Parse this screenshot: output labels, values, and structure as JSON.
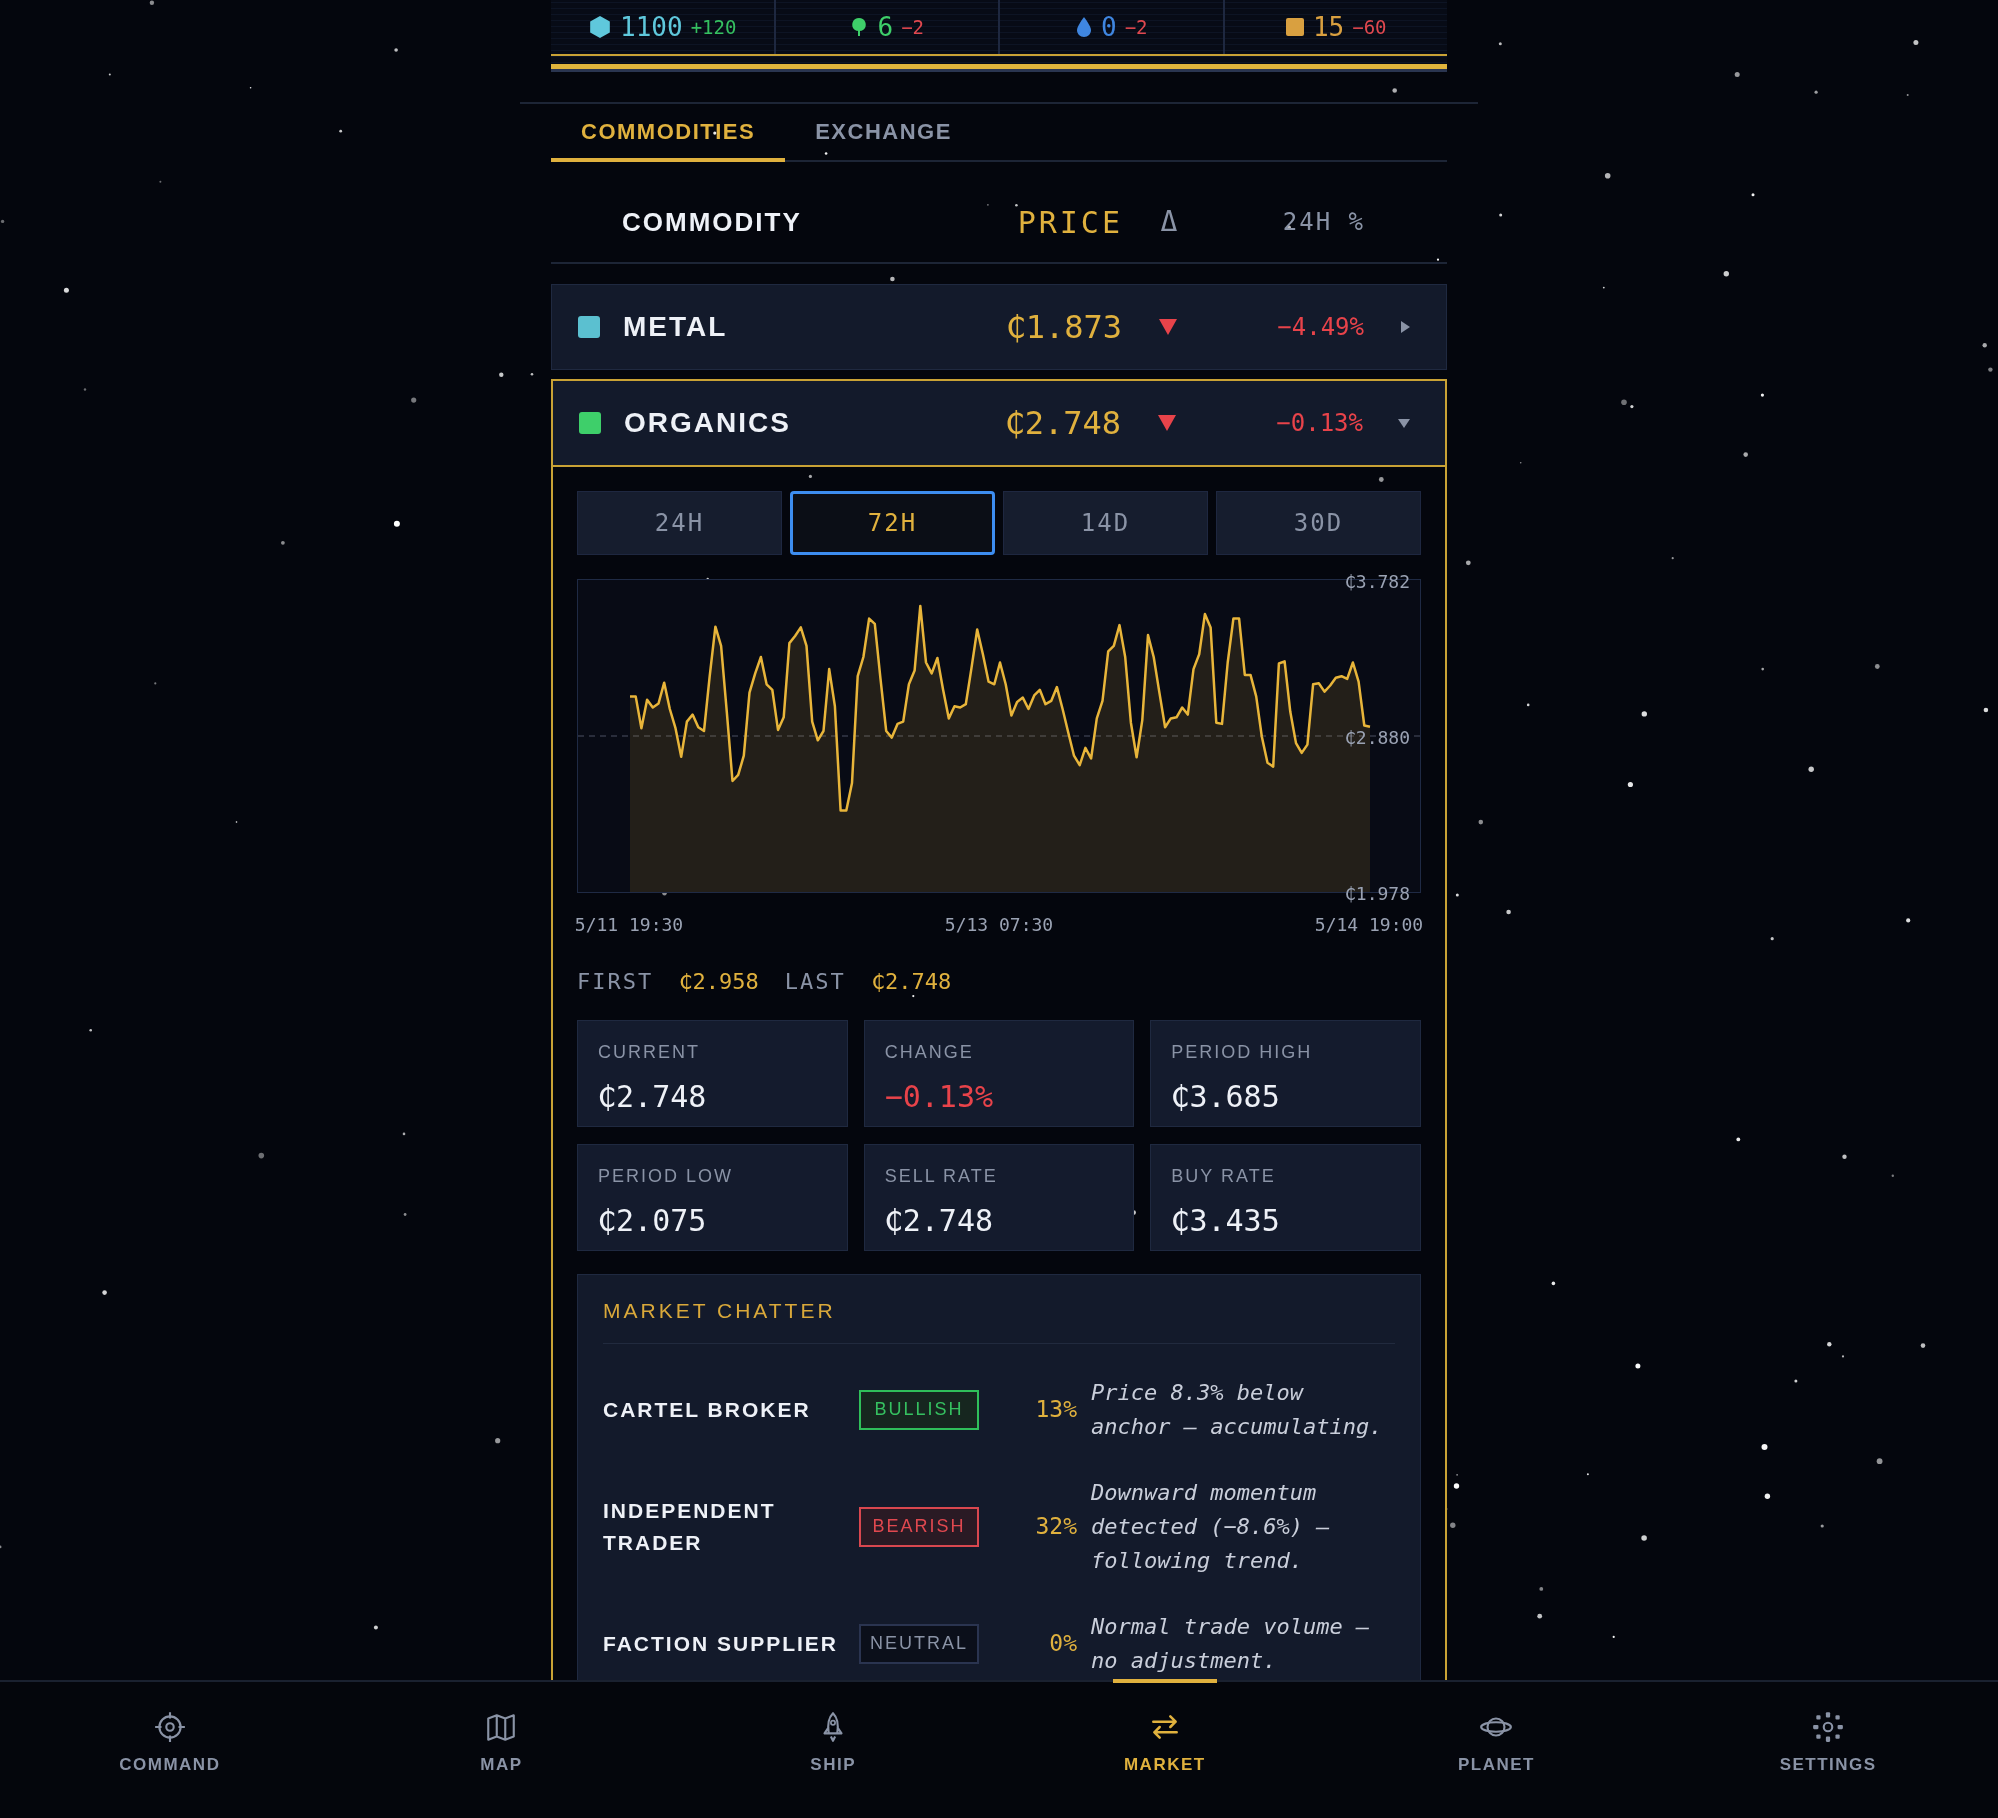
{
  "resources": [
    {
      "kind": "hexagon",
      "color": "#5fc8dc",
      "amount": "1100",
      "delta": "+120",
      "negative": false
    },
    {
      "kind": "leaf",
      "color": "#3ecf6a",
      "amount": "6",
      "delta": "−2",
      "negative": true
    },
    {
      "kind": "drop",
      "color": "#3f86e0",
      "amount": "0",
      "delta": "−2",
      "negative": true
    },
    {
      "kind": "square",
      "color": "#d9a040",
      "amount": "15",
      "delta": "−60",
      "negative": true
    }
  ],
  "tabs": [
    {
      "label": "COMMODITIES",
      "selected": true
    },
    {
      "label": "EXCHANGE",
      "selected": false
    }
  ],
  "table": {
    "columns": [
      "COMMODITY",
      "PRICE",
      "Δ",
      "24H %"
    ],
    "rows": [
      {
        "name": "METAL",
        "color": "#5bc0d0",
        "price": "₵1.873",
        "falling": true,
        "change": "−4.49%",
        "expanded": false
      },
      {
        "name": "ORGANICS",
        "color": "#3ecf6a",
        "price": "₵2.748",
        "falling": true,
        "change": "−0.13%",
        "expanded": true,
        "detail": {
          "periods": [
            {
              "label": "24H",
              "selected": false
            },
            {
              "label": "72H",
              "selected": true
            },
            {
              "label": "14D",
              "selected": false
            },
            {
              "label": "30D",
              "selected": false
            }
          ],
          "chart_data": {
            "type": "area",
            "ylim": [
              1.978,
              3.782
            ],
            "categories": [
              "5/11 19:30",
              null,
              null,
              null,
              null,
              null,
              null,
              null,
              null,
              null,
              null,
              null,
              null,
              null,
              null,
              null,
              null,
              null,
              null,
              null,
              null,
              null,
              null,
              null,
              null,
              null,
              null,
              null,
              null,
              null,
              null,
              null,
              null,
              null,
              null,
              null,
              null,
              null,
              null,
              null,
              null,
              null,
              null,
              null,
              null,
              null,
              null,
              null,
              null,
              null,
              null,
              null,
              null,
              null,
              null,
              null,
              null,
              null,
              null,
              null,
              null,
              null,
              null,
              null,
              null,
              "5/13 07:30",
              null,
              null,
              null,
              null,
              null,
              null,
              null,
              null,
              null,
              null,
              null,
              null,
              null,
              null,
              null,
              null,
              null,
              null,
              null,
              null,
              null,
              null,
              null,
              null,
              null,
              null,
              null,
              null,
              null,
              null,
              null,
              null,
              null,
              null,
              null,
              null,
              null,
              null,
              null,
              null,
              null,
              null,
              null,
              null,
              null,
              null,
              null,
              null,
              null,
              null,
              null,
              null,
              null,
              null,
              null,
              null,
              null,
              null,
              null,
              null,
              null,
              null,
              null,
              null,
              "5/14 19:00"
            ],
            "yticks": [
              {
                "value": 3.782,
                "label": "₵3.782"
              },
              {
                "value": 2.88,
                "label": "₵2.880"
              },
              {
                "value": 1.978,
                "label": "₵1.978"
              }
            ],
            "series": [
              {
                "color": "#e8b53a",
                "values": [
                  3.109,
                  3.109,
                  2.925,
                  3.09,
                  3.045,
                  3.068,
                  3.188,
                  3.036,
                  2.925,
                  2.76,
                  2.963,
                  3.004,
                  2.931,
                  2.909,
                  3.226,
                  3.512,
                  3.401,
                  3.02,
                  2.62,
                  2.655,
                  2.766,
                  3.131,
                  3.242,
                  3.337,
                  3.179,
                  3.147,
                  2.915,
                  2.988,
                  3.417,
                  3.458,
                  3.508,
                  3.401,
                  2.963,
                  2.855,
                  2.909,
                  3.267,
                  3.052,
                  2.449,
                  2.449,
                  2.608,
                  3.226,
                  3.337,
                  3.559,
                  3.528,
                  3.21,
                  2.909,
                  2.871,
                  2.95,
                  2.963,
                  3.179,
                  3.258,
                  3.632,
                  3.305,
                  3.242,
                  3.331,
                  3.147,
                  2.982,
                  3.052,
                  3.045,
                  3.064,
                  3.274,
                  3.496,
                  3.353,
                  3.194,
                  3.179,
                  3.305,
                  3.179,
                  2.998,
                  3.077,
                  3.102,
                  3.036,
                  3.115,
                  3.147,
                  3.064,
                  3.083,
                  3.163,
                  3.036,
                  2.899,
                  2.766,
                  2.712,
                  2.811,
                  2.75,
                  2.982,
                  3.083,
                  3.369,
                  3.401,
                  3.521,
                  3.337,
                  2.957,
                  2.757,
                  2.972,
                  3.464,
                  3.337,
                  3.131,
                  2.931,
                  2.982,
                  2.988,
                  3.045,
                  3.004,
                  3.267,
                  3.353,
                  3.585,
                  3.508,
                  2.957,
                  2.95,
                  3.305,
                  3.559,
                  3.559,
                  3.233,
                  3.233,
                  3.109,
                  2.877,
                  2.725,
                  2.703,
                  3.299,
                  3.312,
                  3.02,
                  2.839,
                  2.782,
                  2.83,
                  3.179,
                  3.185,
                  3.137,
                  3.172,
                  3.217,
                  3.226,
                  3.21,
                  3.305,
                  3.194,
                  2.941,
                  2.934
                ]
              }
            ]
          },
          "first_label": "FIRST",
          "first": "₵2.958",
          "last_label": "LAST",
          "last": "₵2.748",
          "stats": [
            {
              "label": "CURRENT",
              "value": "₵2.748",
              "negative": false
            },
            {
              "label": "CHANGE",
              "value": "−0.13%",
              "negative": true
            },
            {
              "label": "PERIOD HIGH",
              "value": "₵3.685",
              "negative": false
            },
            {
              "label": "PERIOD LOW",
              "value": "₵2.075",
              "negative": false
            },
            {
              "label": "SELL RATE",
              "value": "₵2.748",
              "negative": false
            },
            {
              "label": "BUY RATE",
              "value": "₵3.435",
              "negative": false
            }
          ],
          "chatter": {
            "title": "MARKET CHATTER",
            "rows": [
              {
                "name": "CARTEL BROKER",
                "stance": "BULLISH",
                "kind": "bullish",
                "share": "13%",
                "comment": "Price 8.3% below anchor — accumulating."
              },
              {
                "name": "INDEPENDENT TRADER",
                "stance": "BEARISH",
                "kind": "bearish",
                "share": "32%",
                "comment": "Downward momentum detected (−8.6%) — following trend."
              },
              {
                "name": "FACTION SUPPLIER",
                "stance": "NEUTRAL",
                "kind": "neutral",
                "share": "0%",
                "comment": "Normal trade volume — no adjustment."
              }
            ]
          }
        }
      }
    ]
  },
  "nav": [
    {
      "label": "COMMAND",
      "kind": "crosshair",
      "selected": false
    },
    {
      "label": "MAP",
      "kind": "map",
      "selected": false
    },
    {
      "label": "SHIP",
      "kind": "rocket",
      "selected": false
    },
    {
      "label": "MARKET",
      "kind": "swap",
      "selected": true
    },
    {
      "label": "PLANET",
      "kind": "planet",
      "selected": false
    },
    {
      "label": "SETTINGS",
      "kind": "gear",
      "selected": false
    }
  ]
}
